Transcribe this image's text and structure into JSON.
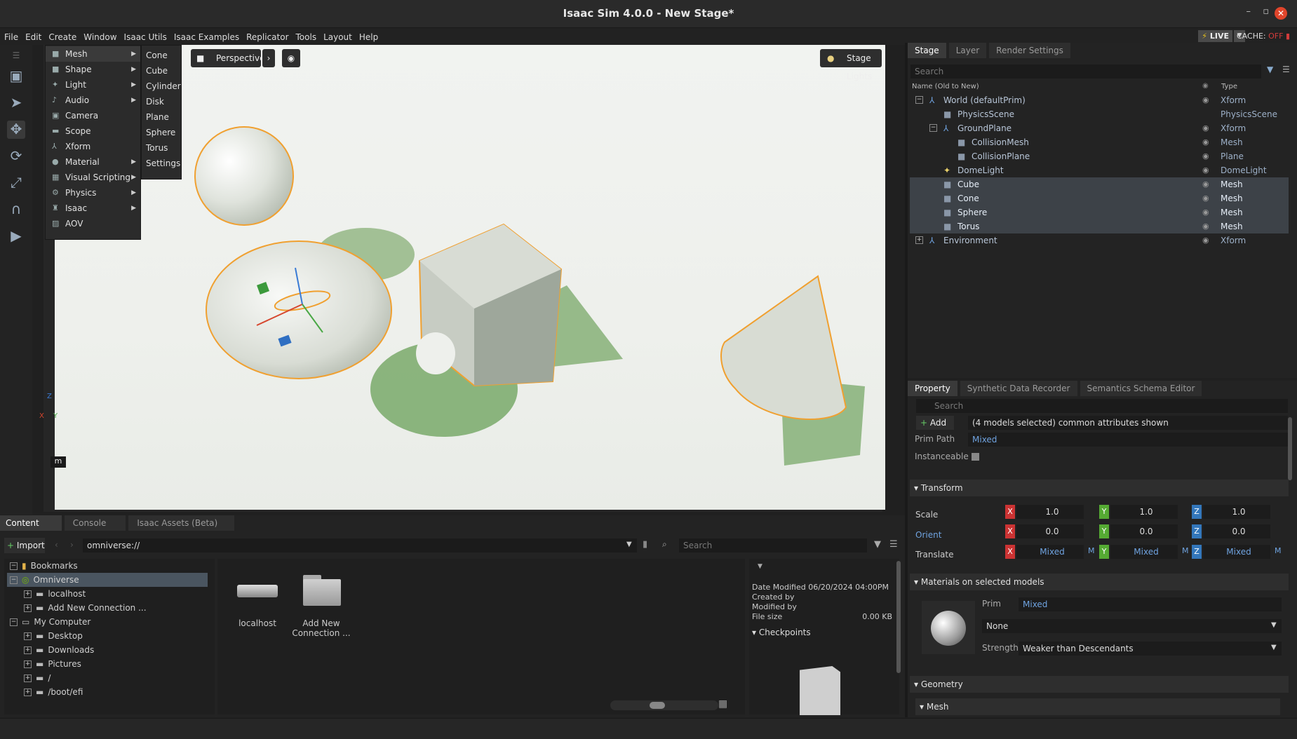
{
  "window": {
    "title": "Isaac Sim 4.0.0 - New Stage*"
  },
  "menubar": {
    "items": [
      "File",
      "Edit",
      "Create",
      "Window",
      "Isaac Utils",
      "Isaac Examples",
      "Replicator",
      "Tools",
      "Layout",
      "Help"
    ],
    "live": "LIVE",
    "cache_label": "CACHE:",
    "cache_state": "OFF"
  },
  "create_menu": {
    "items": [
      {
        "label": "Mesh",
        "icon": "cube-icon",
        "sub": true
      },
      {
        "label": "Shape",
        "icon": "cube-icon",
        "sub": true
      },
      {
        "label": "Light",
        "icon": "light-icon",
        "sub": true
      },
      {
        "label": "Audio",
        "icon": "audio-icon",
        "sub": true
      },
      {
        "label": "Camera",
        "icon": "camera-icon",
        "sub": false
      },
      {
        "label": "Scope",
        "icon": "folder-icon",
        "sub": false
      },
      {
        "label": "Xform",
        "icon": "xform-icon",
        "sub": false
      },
      {
        "label": "Material",
        "icon": "sphere-icon",
        "sub": true
      },
      {
        "label": "Visual Scripting",
        "icon": "graph-icon",
        "sub": true
      },
      {
        "label": "Physics",
        "icon": "physics-icon",
        "sub": true
      },
      {
        "label": "Isaac",
        "icon": "robot-icon",
        "sub": true
      },
      {
        "label": "AOV",
        "icon": "image-icon",
        "sub": false
      }
    ]
  },
  "mesh_submenu": {
    "items": [
      "Cone",
      "Cube",
      "Cylinder",
      "Disk",
      "Plane",
      "Sphere",
      "Torus",
      "Settings"
    ]
  },
  "viewport": {
    "camera": "Perspective",
    "stage_lights": "Stage Lights",
    "units": "m",
    "axis_labels": [
      "Z",
      "X",
      "Y"
    ]
  },
  "stage": {
    "tabs": [
      "Stage",
      "Layer",
      "Render Settings"
    ],
    "search_placeholder": "Search",
    "col_name": "Name (Old to New)",
    "col_type": "Type",
    "rows": [
      {
        "name": "World (defaultPrim)",
        "type": "Xform",
        "indent": 0,
        "fold": "minus",
        "eye": true,
        "sel": false
      },
      {
        "name": "PhysicsScene",
        "type": "PhysicsScene",
        "indent": 1,
        "fold": "",
        "eye": false,
        "sel": false
      },
      {
        "name": "GroundPlane",
        "type": "Xform",
        "indent": 1,
        "fold": "minus",
        "eye": true,
        "sel": false
      },
      {
        "name": "CollisionMesh",
        "type": "Mesh",
        "indent": 2,
        "fold": "",
        "eye": true,
        "sel": false
      },
      {
        "name": "CollisionPlane",
        "type": "Plane",
        "indent": 2,
        "fold": "",
        "eye": true,
        "sel": false
      },
      {
        "name": "DomeLight",
        "type": "DomeLight",
        "indent": 1,
        "fold": "",
        "eye": true,
        "sel": false
      },
      {
        "name": "Cube",
        "type": "Mesh",
        "indent": 1,
        "fold": "",
        "eye": true,
        "sel": true
      },
      {
        "name": "Cone",
        "type": "Mesh",
        "indent": 1,
        "fold": "",
        "eye": true,
        "sel": true
      },
      {
        "name": "Sphere",
        "type": "Mesh",
        "indent": 1,
        "fold": "",
        "eye": true,
        "sel": true
      },
      {
        "name": "Torus",
        "type": "Mesh",
        "indent": 1,
        "fold": "",
        "eye": true,
        "sel": true
      },
      {
        "name": "Environment",
        "type": "Xform",
        "indent": 0,
        "fold": "plus",
        "eye": true,
        "sel": false
      }
    ]
  },
  "property": {
    "tabs": [
      "Property",
      "Synthetic Data Recorder",
      "Semantics Schema Editor"
    ],
    "search_placeholder": "Search",
    "add": "Add",
    "summary": "(4 models selected) common attributes shown",
    "prim_path_label": "Prim Path",
    "prim_path": "Mixed",
    "instanceable_label": "Instanceable",
    "transform": "Transform",
    "scale_label": "Scale",
    "scale": [
      "1.0",
      "1.0",
      "1.0"
    ],
    "orient_label": "Orient",
    "orient": [
      "0.0",
      "0.0",
      "0.0"
    ],
    "translate_label": "Translate",
    "translate": [
      "Mixed",
      "Mixed",
      "Mixed"
    ],
    "mixed_flag": "M",
    "materials": "Materials on selected models",
    "prim_label": "Prim",
    "prim_value": "Mixed",
    "material_value": "None",
    "strength_label": "Strength",
    "strength_value": "Weaker than Descendants",
    "geometry": "Geometry",
    "mesh": "Mesh"
  },
  "content": {
    "tabs": [
      "Content",
      "Console",
      "Isaac Assets (Beta)"
    ],
    "import": "Import",
    "path": "omniverse://",
    "search_placeholder": "Search",
    "tree": [
      {
        "label": "Bookmarks",
        "indent": 0,
        "fold": "minus",
        "sel": false
      },
      {
        "label": "Omniverse",
        "indent": 0,
        "fold": "minus",
        "sel": true
      },
      {
        "label": "localhost",
        "indent": 1,
        "fold": "plus",
        "sel": false
      },
      {
        "label": "Add New Connection ...",
        "indent": 1,
        "fold": "plus",
        "sel": false
      },
      {
        "label": "My Computer",
        "indent": 0,
        "fold": "minus",
        "sel": false
      },
      {
        "label": "Desktop",
        "indent": 1,
        "fold": "plus",
        "sel": false
      },
      {
        "label": "Downloads",
        "indent": 1,
        "fold": "plus",
        "sel": false
      },
      {
        "label": "Pictures",
        "indent": 1,
        "fold": "plus",
        "sel": false
      },
      {
        "label": "/",
        "indent": 1,
        "fold": "plus",
        "sel": false
      },
      {
        "label": "/boot/efi",
        "indent": 1,
        "fold": "plus",
        "sel": false
      }
    ],
    "items": [
      {
        "label": "localhost"
      },
      {
        "label": "Add New Connection ..."
      }
    ],
    "details": {
      "date_modified": "Date Modified 06/20/2024 04:00PM",
      "created_by": "Created by",
      "modified_by": "Modified by",
      "file_size_label": "File size",
      "file_size": "0.00 KB",
      "checkpoints": "Checkpoints"
    }
  }
}
